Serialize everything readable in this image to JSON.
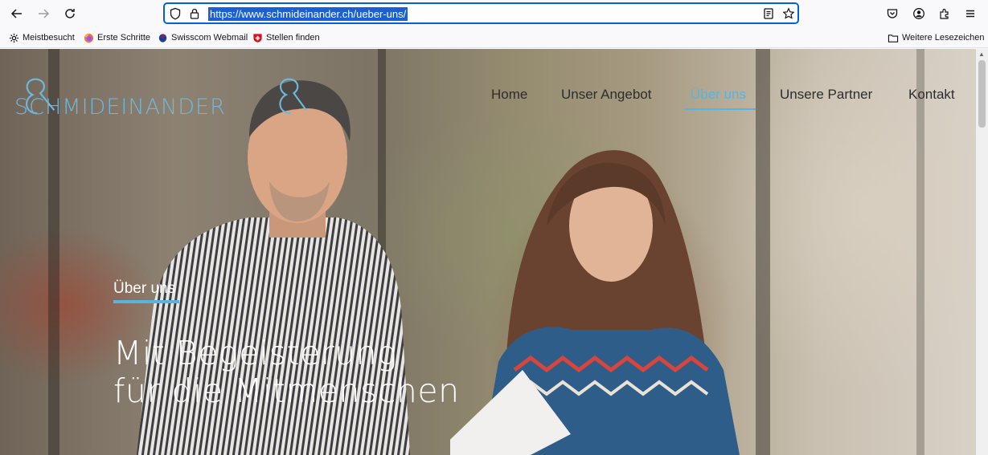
{
  "browser": {
    "url": "https://www.schmideinander.ch/ueber-uns/",
    "bookmarks": [
      {
        "label": "Meistbesucht",
        "icon": "gear-icon"
      },
      {
        "label": "Erste Schritte",
        "icon": "firefox-icon"
      },
      {
        "label": "Swisscom Webmail",
        "icon": "swisscom-icon"
      },
      {
        "label": "Stellen finden",
        "icon": "swiss-cross-icon"
      }
    ],
    "other_bookmarks": "Weitere Lesezeichen"
  },
  "site": {
    "logo_text": "SCHMIDEINANDER",
    "nav": [
      {
        "label": "Home",
        "active": false
      },
      {
        "label": "Unser Angebot",
        "active": false
      },
      {
        "label": "Über uns",
        "active": true
      },
      {
        "label": "Unsere Partner",
        "active": false
      },
      {
        "label": "Kontakt",
        "active": false
      }
    ],
    "accent_color": "#58b3e0"
  },
  "hero": {
    "eyebrow": "Über uns",
    "title_line1": "Mit Begeisterung",
    "title_line2": "für die Mitmenschen"
  }
}
